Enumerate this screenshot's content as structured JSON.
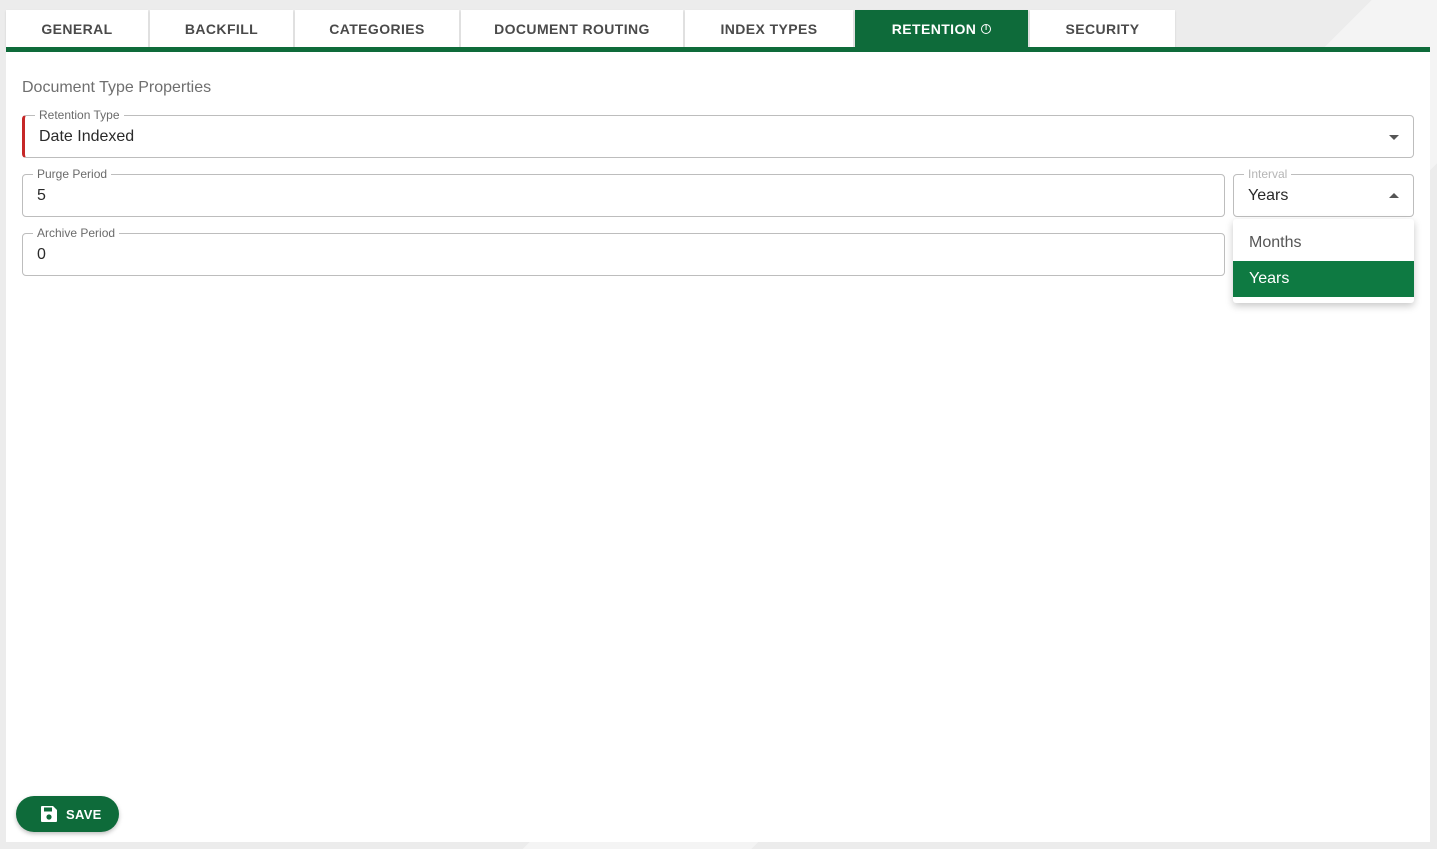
{
  "tabs": [
    {
      "label": "GENERAL"
    },
    {
      "label": "BACKFILL"
    },
    {
      "label": "CATEGORIES"
    },
    {
      "label": "DOCUMENT ROUTING"
    },
    {
      "label": "INDEX TYPES"
    },
    {
      "label": "RETENTION",
      "active": true,
      "icon": "info-icon"
    },
    {
      "label": "SECURITY"
    }
  ],
  "section_title": "Document Type Properties",
  "retention_type": {
    "label": "Retention Type",
    "value": "Date Indexed"
  },
  "purge_period": {
    "label": "Purge Period",
    "value": "5"
  },
  "interval": {
    "label": "Interval",
    "value": "Years",
    "options": [
      "Months",
      "Years"
    ],
    "selected": "Years"
  },
  "archive_period": {
    "label": "Archive Period",
    "value": "0"
  },
  "save_button": {
    "label": "SAVE",
    "icon": "floppy-disk-icon"
  },
  "colors": {
    "accent": "#0e6b3a",
    "error": "#c62828"
  }
}
